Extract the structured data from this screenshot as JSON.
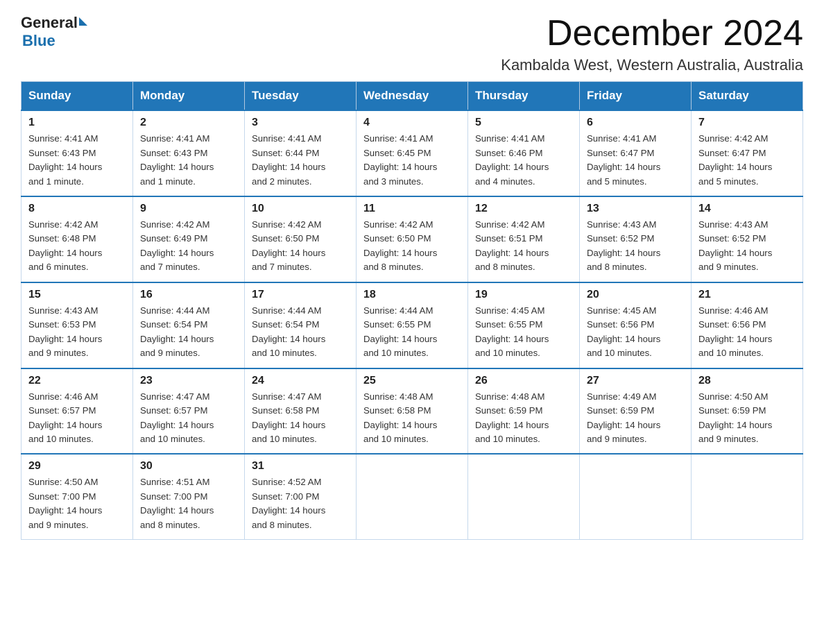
{
  "header": {
    "logo_general": "General",
    "logo_blue": "Blue",
    "month_title": "December 2024",
    "location": "Kambalda West, Western Australia, Australia"
  },
  "days_of_week": [
    "Sunday",
    "Monday",
    "Tuesday",
    "Wednesday",
    "Thursday",
    "Friday",
    "Saturday"
  ],
  "weeks": [
    [
      {
        "day": "1",
        "sunrise": "4:41 AM",
        "sunset": "6:43 PM",
        "daylight": "14 hours and 1 minute."
      },
      {
        "day": "2",
        "sunrise": "4:41 AM",
        "sunset": "6:43 PM",
        "daylight": "14 hours and 1 minute."
      },
      {
        "day": "3",
        "sunrise": "4:41 AM",
        "sunset": "6:44 PM",
        "daylight": "14 hours and 2 minutes."
      },
      {
        "day": "4",
        "sunrise": "4:41 AM",
        "sunset": "6:45 PM",
        "daylight": "14 hours and 3 minutes."
      },
      {
        "day": "5",
        "sunrise": "4:41 AM",
        "sunset": "6:46 PM",
        "daylight": "14 hours and 4 minutes."
      },
      {
        "day": "6",
        "sunrise": "4:41 AM",
        "sunset": "6:47 PM",
        "daylight": "14 hours and 5 minutes."
      },
      {
        "day": "7",
        "sunrise": "4:42 AM",
        "sunset": "6:47 PM",
        "daylight": "14 hours and 5 minutes."
      }
    ],
    [
      {
        "day": "8",
        "sunrise": "4:42 AM",
        "sunset": "6:48 PM",
        "daylight": "14 hours and 6 minutes."
      },
      {
        "day": "9",
        "sunrise": "4:42 AM",
        "sunset": "6:49 PM",
        "daylight": "14 hours and 7 minutes."
      },
      {
        "day": "10",
        "sunrise": "4:42 AM",
        "sunset": "6:50 PM",
        "daylight": "14 hours and 7 minutes."
      },
      {
        "day": "11",
        "sunrise": "4:42 AM",
        "sunset": "6:50 PM",
        "daylight": "14 hours and 8 minutes."
      },
      {
        "day": "12",
        "sunrise": "4:42 AM",
        "sunset": "6:51 PM",
        "daylight": "14 hours and 8 minutes."
      },
      {
        "day": "13",
        "sunrise": "4:43 AM",
        "sunset": "6:52 PM",
        "daylight": "14 hours and 8 minutes."
      },
      {
        "day": "14",
        "sunrise": "4:43 AM",
        "sunset": "6:52 PM",
        "daylight": "14 hours and 9 minutes."
      }
    ],
    [
      {
        "day": "15",
        "sunrise": "4:43 AM",
        "sunset": "6:53 PM",
        "daylight": "14 hours and 9 minutes."
      },
      {
        "day": "16",
        "sunrise": "4:44 AM",
        "sunset": "6:54 PM",
        "daylight": "14 hours and 9 minutes."
      },
      {
        "day": "17",
        "sunrise": "4:44 AM",
        "sunset": "6:54 PM",
        "daylight": "14 hours and 10 minutes."
      },
      {
        "day": "18",
        "sunrise": "4:44 AM",
        "sunset": "6:55 PM",
        "daylight": "14 hours and 10 minutes."
      },
      {
        "day": "19",
        "sunrise": "4:45 AM",
        "sunset": "6:55 PM",
        "daylight": "14 hours and 10 minutes."
      },
      {
        "day": "20",
        "sunrise": "4:45 AM",
        "sunset": "6:56 PM",
        "daylight": "14 hours and 10 minutes."
      },
      {
        "day": "21",
        "sunrise": "4:46 AM",
        "sunset": "6:56 PM",
        "daylight": "14 hours and 10 minutes."
      }
    ],
    [
      {
        "day": "22",
        "sunrise": "4:46 AM",
        "sunset": "6:57 PM",
        "daylight": "14 hours and 10 minutes."
      },
      {
        "day": "23",
        "sunrise": "4:47 AM",
        "sunset": "6:57 PM",
        "daylight": "14 hours and 10 minutes."
      },
      {
        "day": "24",
        "sunrise": "4:47 AM",
        "sunset": "6:58 PM",
        "daylight": "14 hours and 10 minutes."
      },
      {
        "day": "25",
        "sunrise": "4:48 AM",
        "sunset": "6:58 PM",
        "daylight": "14 hours and 10 minutes."
      },
      {
        "day": "26",
        "sunrise": "4:48 AM",
        "sunset": "6:59 PM",
        "daylight": "14 hours and 10 minutes."
      },
      {
        "day": "27",
        "sunrise": "4:49 AM",
        "sunset": "6:59 PM",
        "daylight": "14 hours and 9 minutes."
      },
      {
        "day": "28",
        "sunrise": "4:50 AM",
        "sunset": "6:59 PM",
        "daylight": "14 hours and 9 minutes."
      }
    ],
    [
      {
        "day": "29",
        "sunrise": "4:50 AM",
        "sunset": "7:00 PM",
        "daylight": "14 hours and 9 minutes."
      },
      {
        "day": "30",
        "sunrise": "4:51 AM",
        "sunset": "7:00 PM",
        "daylight": "14 hours and 8 minutes."
      },
      {
        "day": "31",
        "sunrise": "4:52 AM",
        "sunset": "7:00 PM",
        "daylight": "14 hours and 8 minutes."
      },
      null,
      null,
      null,
      null
    ]
  ],
  "labels": {
    "sunrise": "Sunrise:",
    "sunset": "Sunset:",
    "daylight": "Daylight:"
  }
}
